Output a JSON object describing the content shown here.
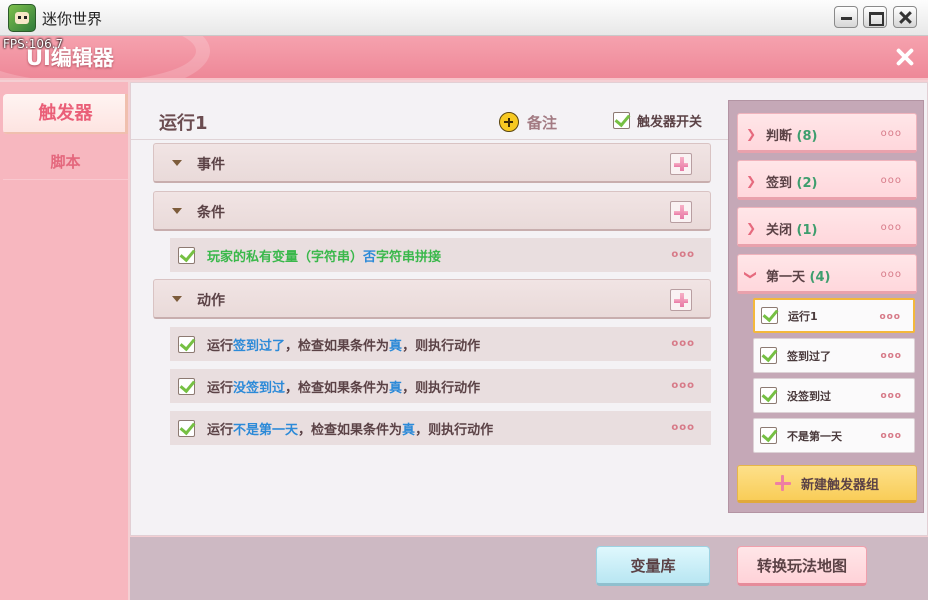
{
  "window": {
    "title": "迷你世界",
    "fps": "FPS:106.7"
  },
  "header": {
    "title": "UI编辑器"
  },
  "sidebar": {
    "tabs": [
      {
        "label": "触发器",
        "active": true
      },
      {
        "label": "脚本",
        "active": false
      }
    ]
  },
  "main": {
    "title": "运行1",
    "note_label": "备注",
    "switch_label": "触发器开关",
    "sections": {
      "event": {
        "label": "事件"
      },
      "condition": {
        "label": "条件",
        "rows": [
          {
            "parts": [
              "玩家的私有变量（字符串）",
              "否",
              "字符串拼接"
            ]
          }
        ]
      },
      "action": {
        "label": "动作",
        "rows": [
          {
            "pre": "运行",
            "name": "签到过了",
            "mid": "，检查如果条件为",
            "val": "真",
            "post": "，则执行动作"
          },
          {
            "pre": "运行",
            "name": "没签到过",
            "mid": "，检查如果条件为",
            "val": "真",
            "post": "，则执行动作"
          },
          {
            "pre": "运行",
            "name": "不是第一天",
            "mid": "，检查如果条件为",
            "val": "真",
            "post": "，则执行动作"
          }
        ]
      }
    }
  },
  "right_panel": {
    "groups": [
      {
        "label": "判断",
        "count": "(8)"
      },
      {
        "label": "签到",
        "count": "(2)"
      },
      {
        "label": "关闭",
        "count": "(1)"
      },
      {
        "label": "第一天",
        "count": "(4)"
      }
    ],
    "triggers": [
      {
        "label": "运行1",
        "selected": true
      },
      {
        "label": "签到过了",
        "selected": false
      },
      {
        "label": "没签到过",
        "selected": false
      },
      {
        "label": "不是第一天",
        "selected": false
      }
    ],
    "new_group_label": "新建触发器组"
  },
  "footer": {
    "variable_lib": "变量库",
    "switch_map": "转换玩法地图"
  },
  "dots": "ooo"
}
